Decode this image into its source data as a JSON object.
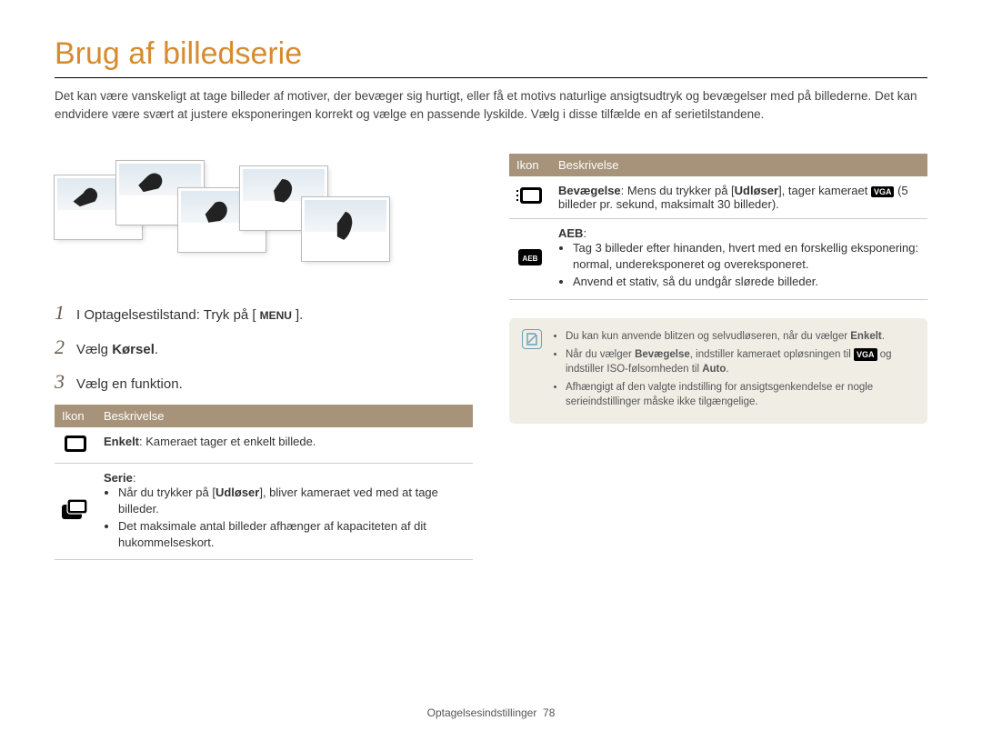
{
  "title": "Brug af billedserie",
  "intro": "Det kan være vanskeligt at tage billeder af motiver, der bevæger sig hurtigt, eller få et motivs naturlige ansigtsudtryk og bevægelser med på billederne. Det kan endvidere være svært at justere eksponeringen korrekt og vælge en passende lyskilde. Vælg i disse tilfælde en af serietilstandene.",
  "steps": {
    "s1_pre": "I Optagelsestilstand: Tryk på [",
    "s1_menu": "MENU",
    "s1_post": "].",
    "s2_pre": "Vælg ",
    "s2_bold": "Kørsel",
    "s2_post": ".",
    "s3": "Vælg en funktion."
  },
  "table_left": {
    "h_icon": "Ikon",
    "h_desc": "Beskrivelse",
    "r1_name": "Enkelt",
    "r1_text": ": Kameraet tager et enkelt billede.",
    "r2_name": "Serie",
    "r2_colon": ":",
    "r2_b1_pre": "Når du trykker på [",
    "r2_b1_bold": "Udløser",
    "r2_b1_post": "], bliver kameraet ved med at tage billeder.",
    "r2_b2": "Det maksimale antal billeder afhænger af kapaciteten af dit hukommelseskort."
  },
  "table_right": {
    "h_icon": "Ikon",
    "h_desc": "Beskrivelse",
    "r1_name": "Bevægelse",
    "r1_pre": ": Mens du trykker på [",
    "r1_bold": "Udløser",
    "r1_mid": "], tager kameraet ",
    "r1_vga": "VGA",
    "r1_post": " (5 billeder pr. sekund, maksimalt 30 billeder).",
    "r2_name": "AEB",
    "r2_colon": ":",
    "r2_b1": "Tag 3 billeder efter hinanden, hvert med en forskellig eksponering: normal, undereksponeret og overeksponeret.",
    "r2_b2": "Anvend et stativ, så du undgår slørede billeder."
  },
  "note": {
    "n1_pre": "Du kan kun anvende blitzen og selvudløseren, når du vælger ",
    "n1_bold": "Enkelt",
    "n1_post": ".",
    "n2_pre": "Når du vælger ",
    "n2_bold1": "Bevægelse",
    "n2_mid1": ", indstiller kameraet opløsningen til ",
    "n2_vga": "VGA",
    "n2_mid2": " og indstiller ISO-følsomheden til ",
    "n2_bold2": "Auto",
    "n2_post": ".",
    "n3": "Afhængigt af den valgte indstilling for ansigtsgenkendelse er nogle serieindstillinger måske ikke tilgængelige."
  },
  "footer_section": "Optagelsesindstillinger",
  "footer_page": "78"
}
